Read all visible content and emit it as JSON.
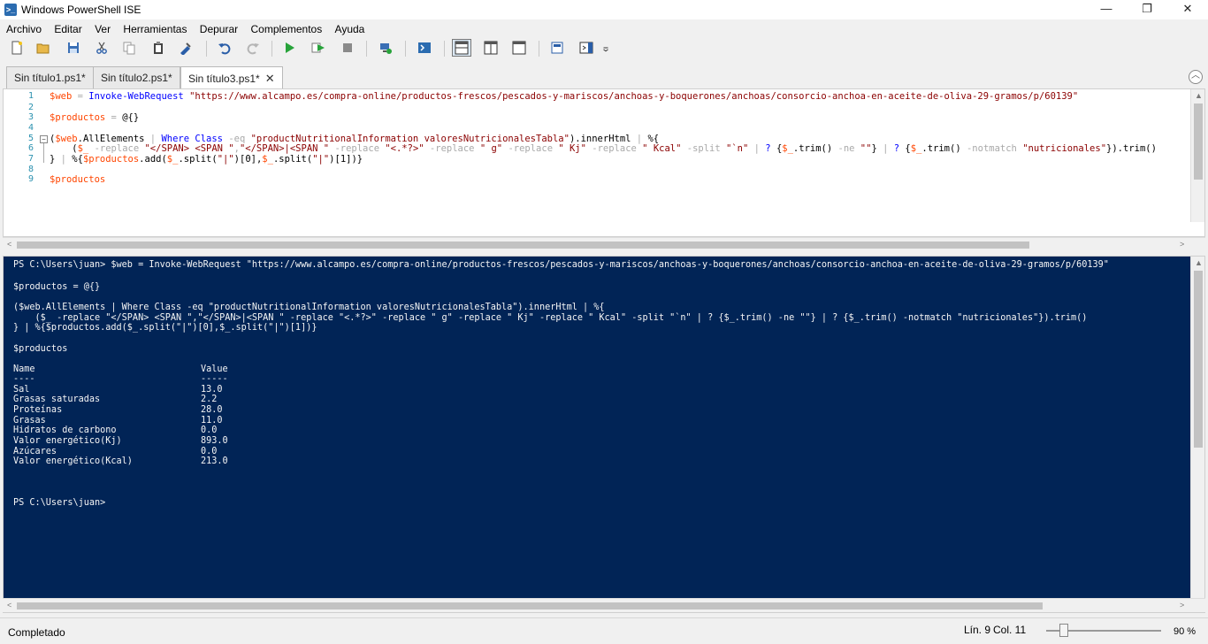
{
  "window": {
    "title": "Windows PowerShell ISE",
    "minimize": "—",
    "maximize": "❐",
    "close": "✕"
  },
  "menu": [
    {
      "label": "Archivo"
    },
    {
      "label": "Editar"
    },
    {
      "label": "Ver"
    },
    {
      "label": "Herramientas"
    },
    {
      "label": "Depurar"
    },
    {
      "label": "Complementos"
    },
    {
      "label": "Ayuda"
    }
  ],
  "toolbar": {
    "icons": [
      "new-file-icon",
      "open-folder-icon",
      "save-icon",
      "cut-icon",
      "copy-icon",
      "paste-icon",
      "clear-console-icon",
      "undo-icon",
      "redo-icon",
      "run-script-icon",
      "run-selection-icon",
      "stop-icon",
      "remote-powershell-icon",
      "start-powershell-icon",
      "show-script-pane-top-icon",
      "show-script-pane-right-icon",
      "show-script-pane-maximized-icon",
      "show-command-window-icon",
      "show-command-addon-icon",
      "customize-toolbar-icon"
    ]
  },
  "tabs": [
    {
      "label": "Sin título1.ps1*"
    },
    {
      "label": "Sin título2.ps1*"
    },
    {
      "label": "Sin título3.ps1*",
      "active": true,
      "close": "✕"
    }
  ],
  "editor": {
    "line_numbers": [
      "1",
      "2",
      "3",
      "4",
      "5",
      "6",
      "7",
      "8",
      "9"
    ],
    "lines": {
      "l1": [
        {
          "t": "$web",
          "c": "c-var"
        },
        {
          "t": " = ",
          "c": "c-op"
        },
        {
          "t": "Invoke-WebRequest",
          "c": "c-cmd"
        },
        {
          "t": " ",
          "c": "c-txt"
        },
        {
          "t": "\"https://www.alcampo.es/compra-online/productos-frescos/pescados-y-mariscos/anchoas-y-boquerones/anchoas/consorcio-anchoa-en-aceite-de-oliva-29-gramos/p/60139\"",
          "c": "c-str"
        }
      ],
      "l3": [
        {
          "t": "$productos",
          "c": "c-var"
        },
        {
          "t": " = ",
          "c": "c-op"
        },
        {
          "t": "@{}",
          "c": "c-txt"
        }
      ],
      "l5": [
        {
          "t": "(",
          "c": "c-txt"
        },
        {
          "t": "$web",
          "c": "c-var"
        },
        {
          "t": ".AllElements",
          "c": "c-txt"
        },
        {
          "t": " | ",
          "c": "c-op"
        },
        {
          "t": "Where",
          "c": "c-cmd"
        },
        {
          "t": " ",
          "c": "c-txt"
        },
        {
          "t": "Class",
          "c": "c-cmd"
        },
        {
          "t": " -eq ",
          "c": "c-op"
        },
        {
          "t": "\"productNutritionalInformation valoresNutricionalesTabla\"",
          "c": "c-str"
        },
        {
          "t": ").innerHtml",
          "c": "c-txt"
        },
        {
          "t": " | ",
          "c": "c-op"
        },
        {
          "t": "%{",
          "c": "c-txt"
        }
      ],
      "l6": [
        {
          "t": "    (",
          "c": "c-txt"
        },
        {
          "t": "$_",
          "c": "c-var"
        },
        {
          "t": " -replace ",
          "c": "c-op"
        },
        {
          "t": "\"</SPAN> <SPAN \"",
          "c": "c-str"
        },
        {
          "t": ",",
          "c": "c-op"
        },
        {
          "t": "\"</SPAN>|<SPAN \"",
          "c": "c-str"
        },
        {
          "t": " -replace ",
          "c": "c-op"
        },
        {
          "t": "\"<.*?>\"",
          "c": "c-str"
        },
        {
          "t": " -replace ",
          "c": "c-op"
        },
        {
          "t": "\" g\"",
          "c": "c-str"
        },
        {
          "t": " -replace ",
          "c": "c-op"
        },
        {
          "t": "\" Kj\"",
          "c": "c-str"
        },
        {
          "t": " -replace ",
          "c": "c-op"
        },
        {
          "t": "\" Kcal\"",
          "c": "c-str"
        },
        {
          "t": " -split ",
          "c": "c-op"
        },
        {
          "t": "\"`n\"",
          "c": "c-str"
        },
        {
          "t": " | ",
          "c": "c-op"
        },
        {
          "t": "? ",
          "c": "c-cmd"
        },
        {
          "t": "{",
          "c": "c-txt"
        },
        {
          "t": "$_",
          "c": "c-var"
        },
        {
          "t": ".trim()",
          "c": "c-txt"
        },
        {
          "t": " -ne ",
          "c": "c-op"
        },
        {
          "t": "\"\"",
          "c": "c-str"
        },
        {
          "t": "}",
          "c": "c-txt"
        },
        {
          "t": " | ",
          "c": "c-op"
        },
        {
          "t": "? ",
          "c": "c-cmd"
        },
        {
          "t": "{",
          "c": "c-txt"
        },
        {
          "t": "$_",
          "c": "c-var"
        },
        {
          "t": ".trim()",
          "c": "c-txt"
        },
        {
          "t": " -notmatch ",
          "c": "c-op"
        },
        {
          "t": "\"nutricionales\"",
          "c": "c-str"
        },
        {
          "t": "}).trim()",
          "c": "c-txt"
        }
      ],
      "l7": [
        {
          "t": "}",
          "c": "c-txt"
        },
        {
          "t": " | ",
          "c": "c-op"
        },
        {
          "t": "%{",
          "c": "c-txt"
        },
        {
          "t": "$productos",
          "c": "c-var"
        },
        {
          "t": ".add(",
          "c": "c-txt"
        },
        {
          "t": "$_",
          "c": "c-var"
        },
        {
          "t": ".split(",
          "c": "c-txt"
        },
        {
          "t": "\"|\"",
          "c": "c-str"
        },
        {
          "t": ")[0],",
          "c": "c-txt"
        },
        {
          "t": "$_",
          "c": "c-var"
        },
        {
          "t": ".split(",
          "c": "c-txt"
        },
        {
          "t": "\"|\"",
          "c": "c-str"
        },
        {
          "t": ")[1])}",
          "c": "c-txt"
        }
      ],
      "l9": [
        {
          "t": "$productos",
          "c": "c-var"
        }
      ]
    }
  },
  "console": {
    "lines": [
      "PS C:\\Users\\juan> $web = Invoke-WebRequest \"https://www.alcampo.es/compra-online/productos-frescos/pescados-y-mariscos/anchoas-y-boquerones/anchoas/consorcio-anchoa-en-aceite-de-oliva-29-gramos/p/60139\"",
      "",
      "$productos = @{}",
      "",
      "($web.AllElements | Where Class -eq \"productNutritionalInformation valoresNutricionalesTabla\").innerHtml | %{",
      "    ($_ -replace \"</SPAN> <SPAN \",\"</SPAN>|<SPAN \" -replace \"<.*?>\" -replace \" g\" -replace \" Kj\" -replace \" Kcal\" -split \"`n\" | ? {$_.trim() -ne \"\"} | ? {$_.trim() -notmatch \"nutricionales\"}).trim()",
      "} | %{$productos.add($_.split(\"|\")[0],$_.split(\"|\")[1])}",
      "",
      "$productos"
    ],
    "table_headers": [
      "Name",
      "Value"
    ],
    "table_underlines": [
      "----",
      "-----"
    ],
    "table_rows": [
      [
        "Sal",
        "13.0"
      ],
      [
        "Grasas saturadas",
        "2.2"
      ],
      [
        "Proteínas",
        "28.0"
      ],
      [
        "Grasas",
        "11.0"
      ],
      [
        "Hidratos de carbono",
        "0.0"
      ],
      [
        "Valor energético(Kj)",
        "893.0"
      ],
      [
        "Azúcares",
        "0.0"
      ],
      [
        "Valor energético(Kcal)",
        "213.0"
      ]
    ],
    "prompt": "PS C:\\Users\\juan>"
  },
  "status": {
    "text": "Completado",
    "line": "Lín. 9",
    "col": "Col. 11",
    "zoom": "90 %",
    "zoom_level": 0.15
  }
}
